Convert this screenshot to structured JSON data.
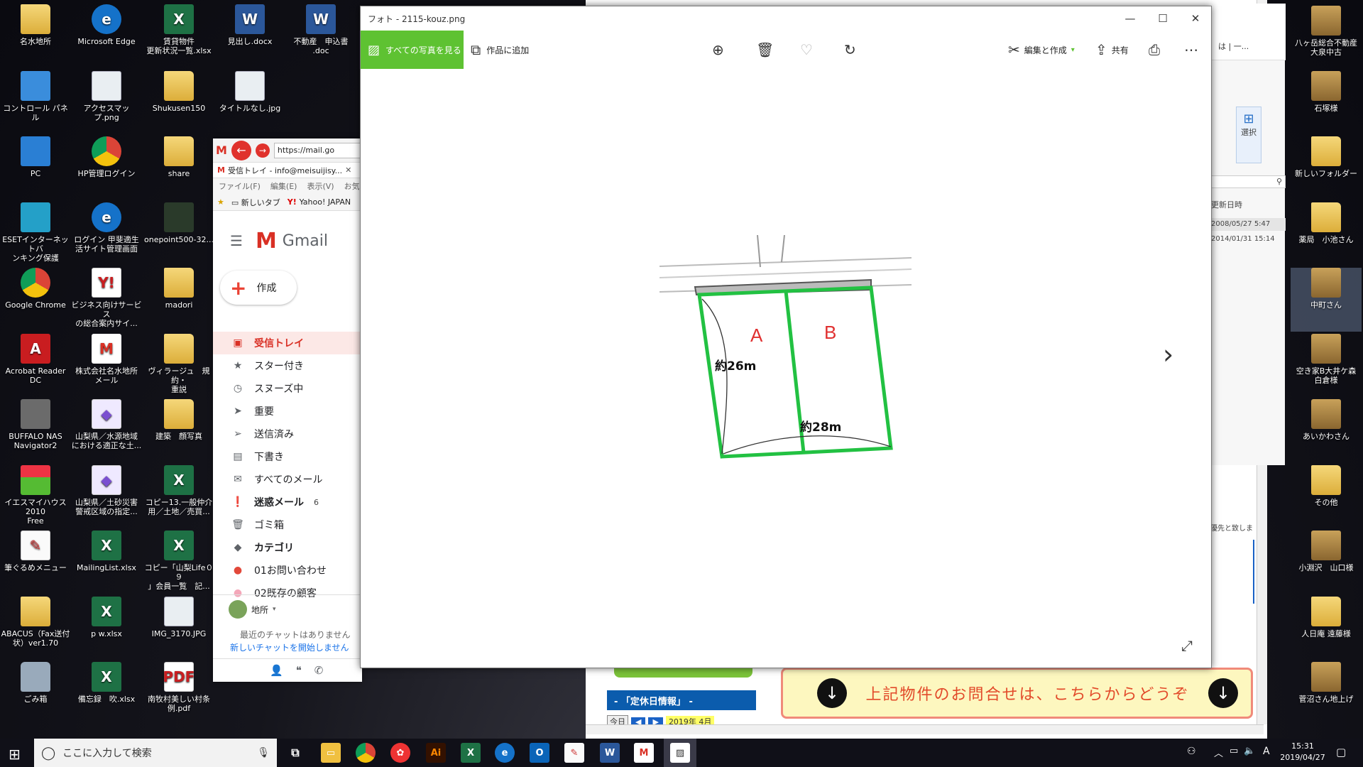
{
  "desktop": {
    "left_icons": [
      {
        "label": "名水地所",
        "kind": "folder",
        "glyph": ""
      },
      {
        "label": "Microsoft Edge",
        "kind": "edge",
        "glyph": "e"
      },
      {
        "label": "賃貸物件\n更新状況一覧.xlsx",
        "kind": "excel",
        "glyph": "X"
      },
      {
        "label": "見出し.docx",
        "kind": "word",
        "glyph": "W"
      },
      {
        "label": "不動産　申込書\n.doc",
        "kind": "word",
        "glyph": "W"
      },
      {
        "label": "コントロール パネル",
        "kind": "blue",
        "glyph": ""
      },
      {
        "label": "アクセスマップ.png",
        "kind": "image",
        "glyph": ""
      },
      {
        "label": "Shukusen150",
        "kind": "folder",
        "glyph": ""
      },
      {
        "label": "タイトルなし.jpg",
        "kind": "image",
        "glyph": ""
      },
      {
        "label": "PC",
        "kind": "pc",
        "glyph": ""
      },
      {
        "label": "HP管理ログイン",
        "kind": "chrome",
        "glyph": ""
      },
      {
        "label": "share",
        "kind": "folder",
        "glyph": ""
      },
      {
        "label": "ESETインターネットバ\nンキング保護",
        "kind": "eset",
        "glyph": ""
      },
      {
        "label": "ログイン 甲斐適生\n活サイト管理画面",
        "kind": "edge",
        "glyph": "e"
      },
      {
        "label": "onepoint500-32...",
        "kind": "dark",
        "glyph": ""
      },
      {
        "label": "Google Chrome",
        "kind": "chrome",
        "glyph": ""
      },
      {
        "label": "ビジネス向けサービス\nの総合案内サイ...",
        "kind": "pdf",
        "glyph": "Y!"
      },
      {
        "label": "madori",
        "kind": "folder",
        "glyph": ""
      },
      {
        "label": "Acrobat Reader\nDC",
        "kind": "acrobat",
        "glyph": "A"
      },
      {
        "label": "株式会社名水地所\nメール",
        "kind": "gmail",
        "glyph": "M"
      },
      {
        "label": "ヴィラージュ　規約・\n重説",
        "kind": "folder",
        "glyph": ""
      },
      {
        "label": "BUFFALO NAS\nNavigator2",
        "kind": "gray",
        "glyph": ""
      },
      {
        "label": "山梨県／水源地域\nにおける適正な土...",
        "kind": "purple",
        "glyph": "◆"
      },
      {
        "label": "建築　顔写真",
        "kind": "folder",
        "glyph": ""
      },
      {
        "label": "イエスマイハウス2010\nFree",
        "kind": "house",
        "glyph": ""
      },
      {
        "label": "山梨県／土砂災害\n警戒区域の指定...",
        "kind": "purple",
        "glyph": "◆"
      },
      {
        "label": "コピー13.一般仲介\n用／土地／売買...",
        "kind": "excel",
        "glyph": "X"
      },
      {
        "label": "筆ぐるめメニュー",
        "kind": "pen",
        "glyph": "✎"
      },
      {
        "label": "MailingList.xlsx",
        "kind": "excel",
        "glyph": "X"
      },
      {
        "label": "コピー「山梨Life０９\n」会員一覧　記...",
        "kind": "excel",
        "glyph": "X"
      },
      {
        "label": "ABACUS（Fax送付\n状）ver1.70",
        "kind": "folder",
        "glyph": ""
      },
      {
        "label": "p w.xlsx",
        "kind": "excel",
        "glyph": "X"
      },
      {
        "label": "IMG_3170.JPG",
        "kind": "image",
        "glyph": ""
      },
      {
        "label": "ごみ箱",
        "kind": "trash",
        "glyph": ""
      },
      {
        "label": "備忘録　吹.xlsx",
        "kind": "excel",
        "glyph": "X"
      },
      {
        "label": "南牧村美しい村条\n例.pdf",
        "kind": "pdf",
        "glyph": "PDF"
      }
    ],
    "right_icons": [
      {
        "label": "八ヶ岳総合不動産\n大泉中古",
        "kind": "door"
      },
      {
        "label": "石塚様",
        "kind": "door"
      },
      {
        "label": "新しいフォルダー",
        "kind": "folder"
      },
      {
        "label": "薬局　小池さん",
        "kind": "folder"
      },
      {
        "label": "中町さん",
        "kind": "door"
      },
      {
        "label": "空き家B大井ケ森\n白倉様",
        "kind": "door"
      },
      {
        "label": "あいかわさん",
        "kind": "door"
      },
      {
        "label": "その他",
        "kind": "folder"
      },
      {
        "label": "小淵沢　山口様",
        "kind": "door"
      },
      {
        "label": "人日庵 遠藤様",
        "kind": "folder"
      },
      {
        "label": "菅沼さん地上げ",
        "kind": "door"
      }
    ]
  },
  "gmail": {
    "url": "https://mail.go",
    "tab_title": "受信トレイ - info@meisuijisy...",
    "menu": [
      "ファイル(F)",
      "編集(E)",
      "表示(V)",
      "お気"
    ],
    "favorites": [
      "新しいタブ",
      "Yahoo! JAPAN"
    ],
    "logo": "Gmail",
    "compose": "作成",
    "nav": [
      {
        "label": "受信トレイ",
        "icon": "▣",
        "active": true,
        "bold": true,
        "count": ""
      },
      {
        "label": "スター付き",
        "icon": "★",
        "active": false,
        "bold": false,
        "count": ""
      },
      {
        "label": "スヌーズ中",
        "icon": "◷",
        "active": false,
        "bold": false,
        "count": ""
      },
      {
        "label": "重要",
        "icon": "➤",
        "active": false,
        "bold": false,
        "count": ""
      },
      {
        "label": "送信済み",
        "icon": "➢",
        "active": false,
        "bold": false,
        "count": ""
      },
      {
        "label": "下書き",
        "icon": "▤",
        "active": false,
        "bold": false,
        "count": ""
      },
      {
        "label": "すべてのメール",
        "icon": "✉",
        "active": false,
        "bold": false,
        "count": ""
      },
      {
        "label": "迷惑メール",
        "icon": "❗",
        "active": false,
        "bold": true,
        "count": "6"
      },
      {
        "label": "ゴミ箱",
        "icon": "🗑",
        "active": false,
        "bold": false,
        "count": ""
      },
      {
        "label": "カテゴリ",
        "icon": "◆",
        "active": false,
        "bold": true,
        "count": ""
      },
      {
        "label": "01お問い合わせ",
        "icon": "●",
        "active": false,
        "bold": false,
        "count": ""
      },
      {
        "label": "02既存の顧客",
        "icon": "●",
        "active": false,
        "bold": false,
        "count": ""
      }
    ],
    "chat_user": "地所",
    "chat_empty": "最近のチャットはありません",
    "chat_start": "新しいチャットを開始しません"
  },
  "background_site": {
    "holiday_header": "- 「定休日情報」 -",
    "calendar_today": "今日",
    "calendar_month": "2019年 4月",
    "inquiry_banner": "上記物件のお問合せは、こちらからどうぞ",
    "side_text": "優先と致しま"
  },
  "explorer": {
    "select_label": "選択",
    "update_date_header": "更新日時",
    "dates": [
      "2008/05/27 5:47",
      "2014/01/31 15:14"
    ],
    "partial": "は | 一..."
  },
  "photos": {
    "title": "フォト - 2115-kouz.png",
    "all_photos": "すべての写真を見る",
    "add_to_creation": "作品に追加",
    "edit_create": "編集と作成",
    "share": "共有",
    "image": {
      "label_a": "A",
      "label_b": "B",
      "dim_vertical": "約26m",
      "dim_horizontal": "約28m"
    }
  },
  "taskbar": {
    "search_placeholder": "ここに入力して検索",
    "time": "15:31",
    "date": "2019/04/27",
    "ime": "A"
  },
  "colors": {
    "photos_accent": "#5ec232",
    "gmail_red": "#d93025",
    "plot_green": "#22c142",
    "site_blue": "#0b5cad"
  }
}
